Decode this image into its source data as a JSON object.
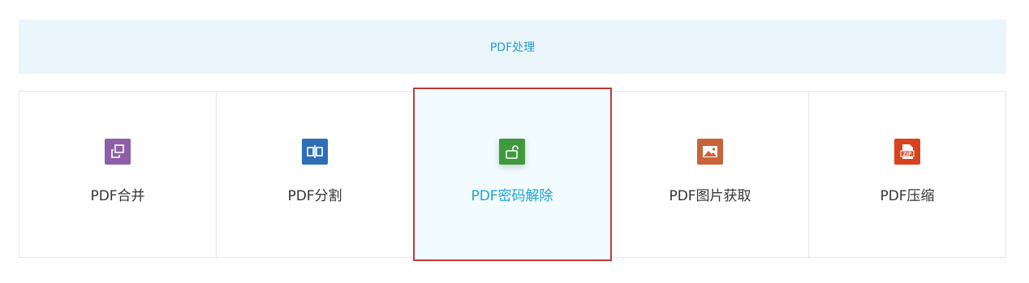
{
  "header": {
    "title": "PDF处理"
  },
  "tools": [
    {
      "label": "PDF合并",
      "icon": "merge-icon",
      "color": "#8d5fa8"
    },
    {
      "label": "PDF分割",
      "icon": "split-icon",
      "color": "#2e6fb7"
    },
    {
      "label": "PDF密码解除",
      "icon": "unlock-icon",
      "color": "#3f9a3d",
      "selected": true
    },
    {
      "label": "PDF图片获取",
      "icon": "image-icon",
      "color": "#c9633a"
    },
    {
      "label": "PDF压缩",
      "icon": "zip-icon",
      "color": "#d9421e"
    }
  ]
}
